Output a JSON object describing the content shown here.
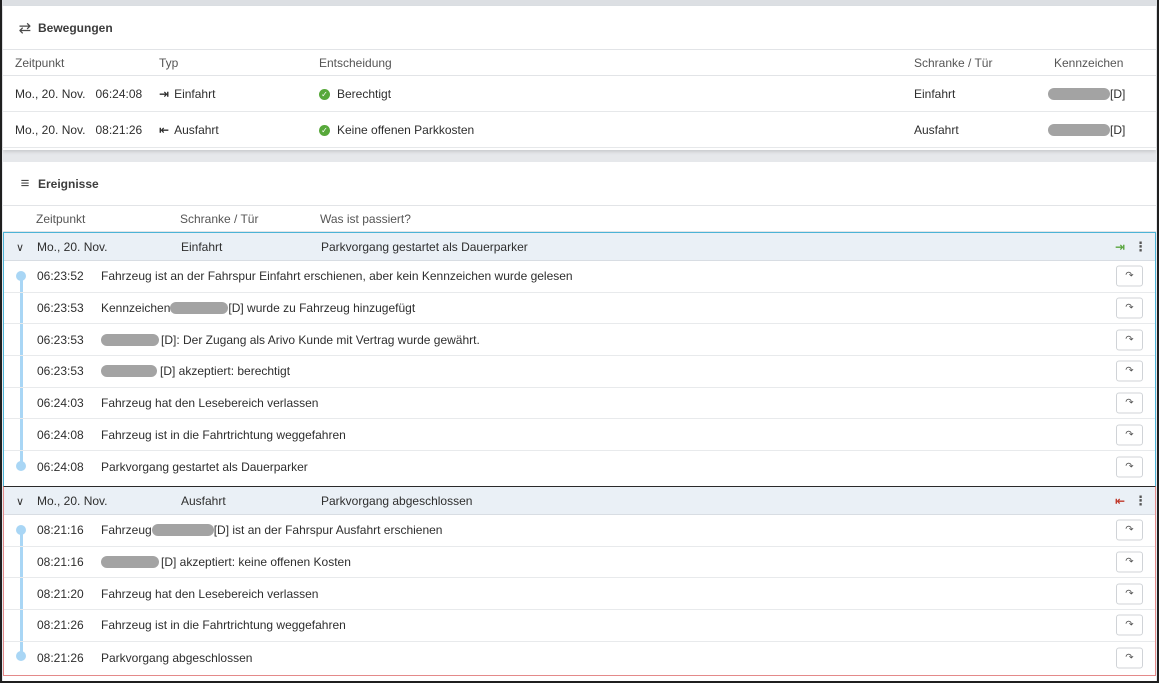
{
  "movements": {
    "title": "Bewegungen",
    "title_icon": "swap-arrows-icon",
    "columns": [
      "Zeitpunkt",
      "Typ",
      "Entscheidung",
      "Schranke / Tür",
      "Kennzeichen"
    ],
    "rows": [
      {
        "time": "Mo., 20. Nov.   06:24:08",
        "type": "Einfahrt",
        "type_icon": "entry-arrow-icon",
        "decision": "Berechtigt",
        "gate": "Einfahrt",
        "plate_suffix": "[D]"
      },
      {
        "time": "Mo., 20. Nov.   08:21:26",
        "type": "Ausfahrt",
        "type_icon": "exit-arrow-icon",
        "decision": "Keine offenen Parkkosten",
        "gate": "Ausfahrt",
        "plate_suffix": "[D]"
      }
    ]
  },
  "events": {
    "title": "Ereignisse",
    "title_icon": "list-icon",
    "columns": [
      "Zeitpunkt",
      "Schranke / Tür",
      "Was ist passiert?"
    ],
    "groups": [
      {
        "date": "Mo., 20. Nov.",
        "gate": "Einfahrt",
        "summary": "Parkvorgang gestartet als Dauerparker",
        "accent": "#4bb3d6",
        "icon_color": "#5aa63f",
        "entries": [
          {
            "time": "06:23:52",
            "pre": "Fahrzeug ist an der Fahrspur Einfahrt erschienen, aber kein Kennzeichen wurde gelesen",
            "post": ""
          },
          {
            "time": "06:23:53",
            "pre": "Kennzeichen",
            "post": "[D] wurde zu Fahrzeug hinzugefügt"
          },
          {
            "time": "06:23:53",
            "pre": "",
            "post": "[D]: Der Zugang als Arivo Kunde mit Vertrag wurde gewährt."
          },
          {
            "time": "06:23:53",
            "pre": "",
            "post": "[D] akzeptiert: berechtigt"
          },
          {
            "time": "06:24:03",
            "pre": "Fahrzeug hat den Lesebereich verlassen",
            "post": ""
          },
          {
            "time": "06:24:08",
            "pre": "Fahrzeug ist in die Fahrtrichtung weggefahren",
            "post": ""
          },
          {
            "time": "06:24:08",
            "pre": "Parkvorgang gestartet als Dauerparker",
            "post": ""
          }
        ]
      },
      {
        "date": "Mo., 20. Nov.",
        "gate": "Ausfahrt",
        "summary": "Parkvorgang abgeschlossen",
        "accent": "#e48a8a",
        "icon_color": "#c0392b",
        "entries": [
          {
            "time": "08:21:16",
            "pre": "Fahrzeug",
            "post": "[D] ist an der Fahrspur Ausfahrt erschienen"
          },
          {
            "time": "08:21:16",
            "pre": "",
            "post": "[D] akzeptiert: keine offenen Kosten"
          },
          {
            "time": "08:21:20",
            "pre": "Fahrzeug hat den Lesebereich verlassen",
            "post": ""
          },
          {
            "time": "08:21:26",
            "pre": "Fahrzeug ist in die Fahrtrichtung weggefahren",
            "post": ""
          },
          {
            "time": "08:21:26",
            "pre": "Parkvorgang abgeschlossen",
            "post": ""
          }
        ]
      }
    ]
  }
}
